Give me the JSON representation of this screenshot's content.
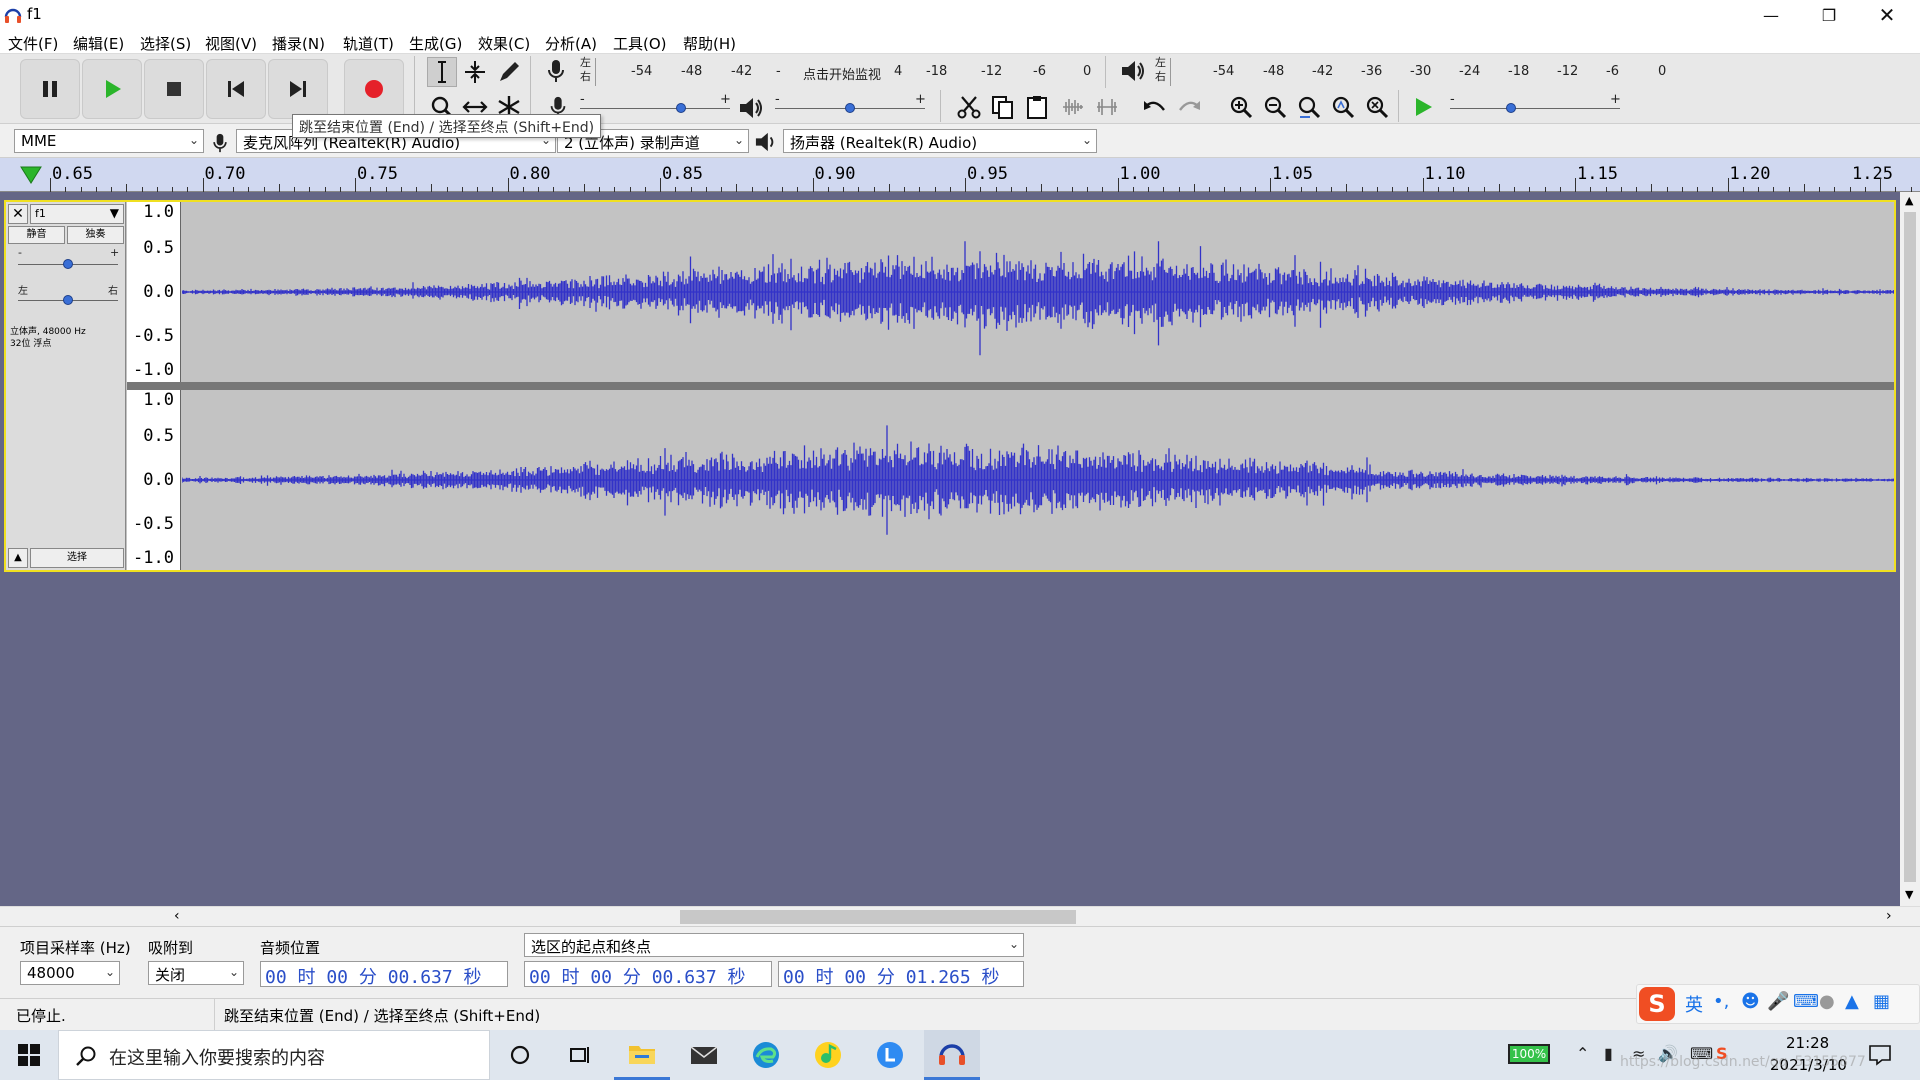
{
  "window": {
    "title": "f1",
    "app_icon": "audacity-headphones-icon",
    "controls": [
      "minimize",
      "restore",
      "close"
    ]
  },
  "menu": [
    "文件(F)",
    "编辑(E)",
    "选择(S)",
    "视图(V)",
    "播录(N)",
    "轨道(T)",
    "生成(G)",
    "效果(C)",
    "分析(A)",
    "工具(O)",
    "帮助(H)"
  ],
  "transport": {
    "buttons": [
      "pause",
      "play",
      "stop",
      "skip-to-start",
      "skip-to-end",
      "record"
    ]
  },
  "meters": {
    "record_lr": [
      "左",
      "右"
    ],
    "record_scale": [
      "-54",
      "-48",
      "-42",
      "-",
      "点击开始监视",
      "4",
      "-18",
      "-12",
      "-6",
      "0"
    ],
    "playback_lr": [
      "左",
      "右"
    ],
    "playback_scale": [
      "-54",
      "-48",
      "-42",
      "-36",
      "-30",
      "-24",
      "-18",
      "-12",
      "-6",
      "0"
    ],
    "slider_minus": "-",
    "slider_plus": "+"
  },
  "device": {
    "host": "MME",
    "mic": "麦克风阵列 (Realtek(R) Audio)",
    "channels": "2 (立体声) 录制声道",
    "speaker": "扬声器 (Realtek(R) Audio)"
  },
  "tooltip": "跳至结束位置 (End) / 选择至终点 (Shift+End)",
  "ruler": {
    "labels": [
      "0.65",
      "0.70",
      "0.75",
      "0.80",
      "0.85",
      "0.90",
      "0.95",
      "1.00",
      "1.05",
      "1.10",
      "1.15",
      "1.20",
      "1.25"
    ]
  },
  "track": {
    "name": "f1",
    "mute": "静音",
    "solo": "独奏",
    "gain_minus": "-",
    "gain_plus": "+",
    "pan_left": "左",
    "pan_right": "右",
    "info_line1": "立体声, 48000 Hz",
    "info_line2": "32位 浮点",
    "select": "选择",
    "vlabels": [
      "1.0",
      "0.5",
      "0.0",
      "-0.5",
      "-1.0"
    ],
    "wave_color": "#3232c8"
  },
  "selection": {
    "rate_label": "项目采样率 (Hz)",
    "rate_value": "48000",
    "snap_label": "吸附到",
    "snap_value": "关闭",
    "audio_pos_label": "音频位置",
    "audio_pos_value": "00 时 00 分 00.637 秒",
    "sel_label": "选区的起点和终点",
    "sel_start": "00 时 00 分 00.637 秒",
    "sel_end": "00 时 00 分 01.265 秒"
  },
  "status": {
    "state": "已停止.",
    "hint": "跳至结束位置 (End) / 选择至终点 (Shift+End)"
  },
  "ime": {
    "lang": "英",
    "punct": "•,"
  },
  "taskbar": {
    "search_placeholder": "在这里输入你要搜索的内容",
    "battery": "100%",
    "time": "21:28",
    "date": "2021/3/10",
    "watermark": "https://blog.csdn.net/qq_53155877"
  }
}
